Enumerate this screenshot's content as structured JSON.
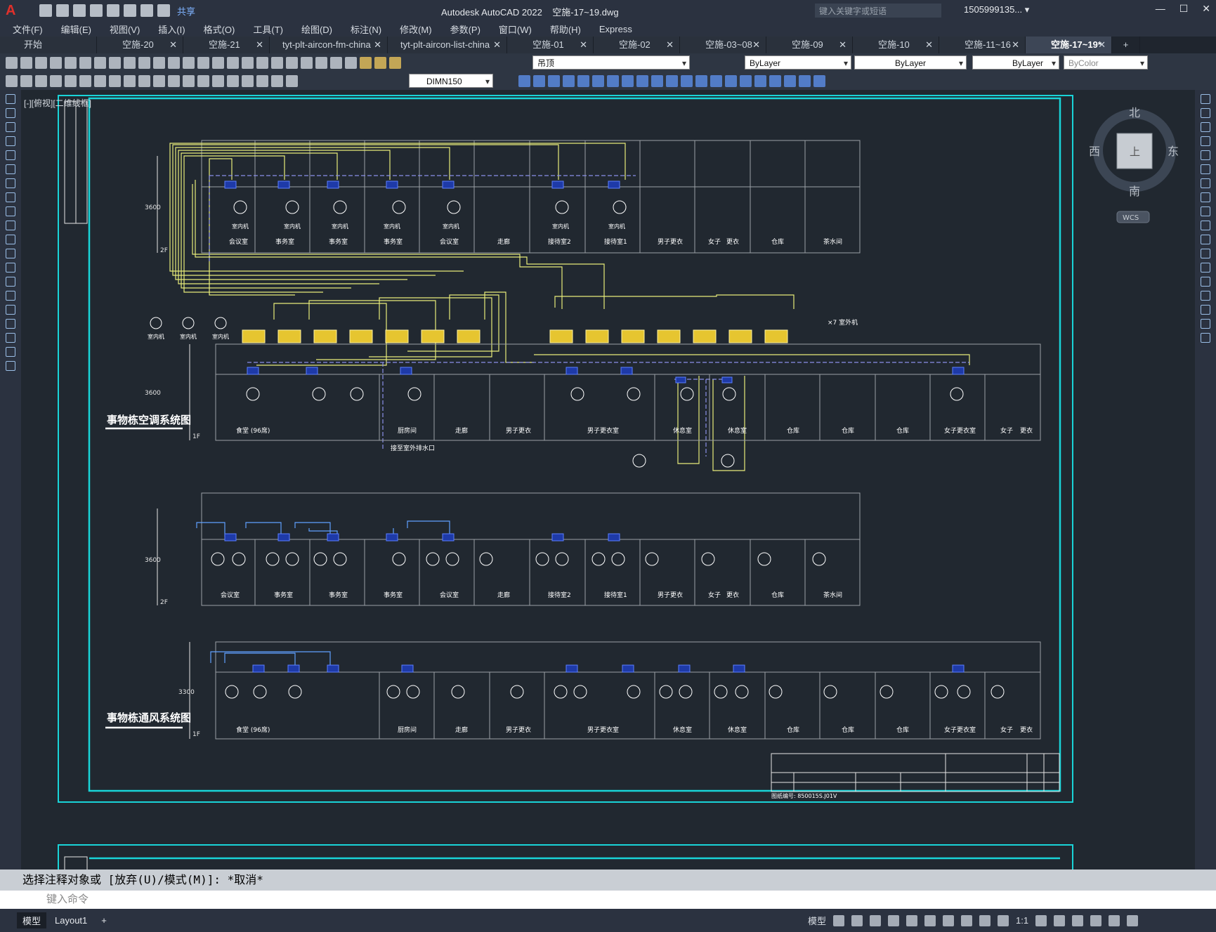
{
  "app": {
    "title": "Autodesk AutoCAD 2022",
    "file": "空施-17~19.dwg",
    "share_label": "共享",
    "search_placeholder": "键入关键字或短语",
    "user": "1505999135... ▾"
  },
  "menu": [
    "文件(F)",
    "编辑(E)",
    "视图(V)",
    "插入(I)",
    "格式(O)",
    "工具(T)",
    "绘图(D)",
    "标注(N)",
    "修改(M)",
    "参数(P)",
    "窗口(W)",
    "帮助(H)",
    "Express"
  ],
  "tabs": [
    {
      "label": "开始",
      "closable": false
    },
    {
      "label": "空施-20",
      "closable": true
    },
    {
      "label": "空施-21",
      "closable": true
    },
    {
      "label": "tyt-plt-aircon-fm-china",
      "closable": true
    },
    {
      "label": "tyt-plt-aircon-list-china",
      "closable": true
    },
    {
      "label": "空施-01",
      "closable": true
    },
    {
      "label": "空施-02",
      "closable": true
    },
    {
      "label": "空施-03~08",
      "closable": true
    },
    {
      "label": "空施-09",
      "closable": true
    },
    {
      "label": "空施-10",
      "closable": true
    },
    {
      "label": "空施-11~16",
      "closable": true
    },
    {
      "label": "空施-17~19*",
      "closable": true,
      "active": true
    }
  ],
  "toolbar": {
    "layer": "吊顶",
    "color": "ByLayer",
    "linetype": "ByLayer",
    "lineweight": "ByLayer",
    "plotstyle": "ByColor",
    "dimstyle": "DIMN150"
  },
  "viewport_label": "[-][俯视][二维线框]",
  "viewcube": {
    "north": "北",
    "south": "南",
    "east": "东",
    "west": "西",
    "face": "上",
    "wcs": "WCS"
  },
  "drawing": {
    "ac_title": "事物栋空调系统图",
    "vent_title": "事物栋通风系统图",
    "levels": {
      "2f": "2F",
      "1f": "1F",
      "h_ac2": "3600",
      "h_ac1": "3600",
      "h_v2": "3600",
      "h_v1": "3300"
    },
    "legend": [
      "室内机",
      "室内机",
      "室内机"
    ],
    "outdoor": "×7 室外机",
    "rooms_2f": [
      "会议室",
      "事务室",
      "事务室",
      "事务室",
      "会议室",
      "走廊",
      "接待室2",
      "接待室1",
      "男子更衣",
      "女子",
      "更衣",
      "仓库",
      "茶水间"
    ],
    "rooms_1f": [
      "食堂 (96席)",
      "厨房间",
      "走廊",
      "男子更衣",
      "男子更衣室",
      "休息室",
      "休息室",
      "仓库",
      "仓库",
      "仓库",
      "女子更衣室",
      "女子",
      "更衣"
    ],
    "drain_note": "接至室外排水口",
    "unit_label": "室内机",
    "title_block_no": "图纸编号: 850015S.J01V"
  },
  "command": {
    "history": "选择注释对象或 [放弃(U)/模式(M)]: *取消*",
    "placeholder": "键入命令"
  },
  "status": {
    "model_tab": "模型",
    "layout_tab": "Layout1",
    "model_btn": "模型",
    "scale": "1:1"
  }
}
